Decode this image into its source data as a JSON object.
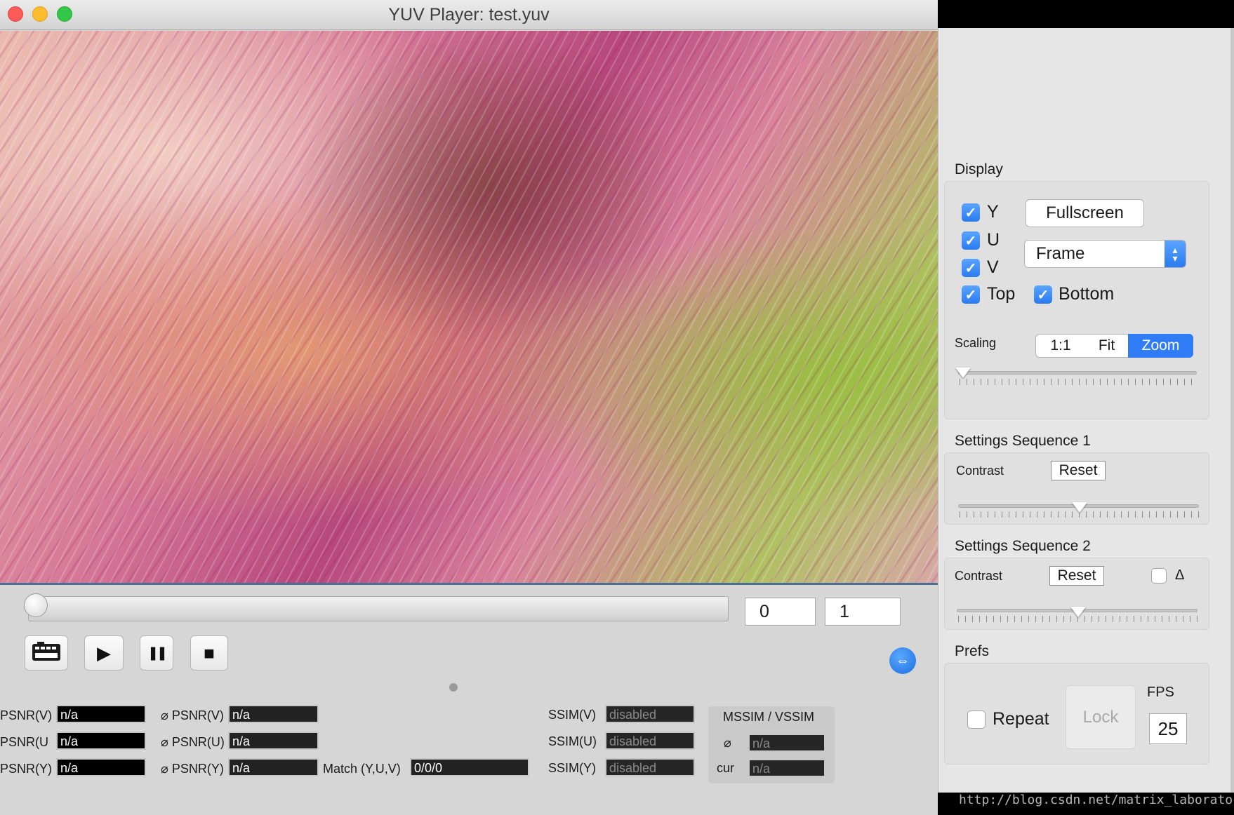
{
  "window": {
    "title": "YUV Player: test.yuv",
    "traffic_lights": {
      "close": "#fc5b57",
      "minimize": "#fdbc2e",
      "zoom": "#33c748"
    }
  },
  "timeline": {
    "position_fraction": 0.0,
    "frame_start": "0",
    "frame_end": "1"
  },
  "transport": {
    "buttons": [
      {
        "name": "snapshot-button",
        "icon": "film-frame-icon"
      },
      {
        "name": "play-button",
        "icon": "play-icon",
        "glyph": "▶"
      },
      {
        "name": "pause-button",
        "icon": "pause-icon",
        "glyph": "❚❚"
      },
      {
        "name": "stop-button",
        "icon": "stop-icon",
        "glyph": "■"
      }
    ],
    "toggle_glyph": "⇔"
  },
  "metrics": {
    "psnr_v_label": "PSNR(V)",
    "psnr_v_value": "n/a",
    "psnr_u_label": "PSNR(U",
    "psnr_u_value": "n/a",
    "psnr_y_label": "PSNR(Y)",
    "psnr_y_value": "n/a",
    "avg_symbol": "⌀",
    "avg_psnr_v_label": "PSNR(V)",
    "avg_psnr_v_value": "n/a",
    "avg_psnr_u_label": "PSNR(U)",
    "avg_psnr_u_value": "n/a",
    "avg_psnr_y_label": "PSNR(Y)",
    "avg_psnr_y_value": "n/a",
    "match_label": "Match (Y,U,V)",
    "match_value": "0/0/0",
    "ssim_v_label": "SSIM(V)",
    "ssim_v_value": "disabled",
    "ssim_u_label": "SSIM(U)",
    "ssim_u_value": "disabled",
    "ssim_y_label": "SSIM(Y)",
    "ssim_y_value": "disabled",
    "mssim_title": "MSSIM / VSSIM",
    "mssim_avg_label": "⌀",
    "mssim_avg_value": "n/a",
    "mssim_cur_label": "cur",
    "mssim_cur_value": "n/a"
  },
  "drawer": {
    "display": {
      "title": "Display",
      "y": {
        "label": "Y",
        "checked": true
      },
      "u": {
        "label": "U",
        "checked": true
      },
      "v": {
        "label": "V",
        "checked": true
      },
      "top": {
        "label": "Top",
        "checked": true
      },
      "bottom": {
        "label": "Bottom",
        "checked": true
      },
      "fullscreen_label": "Fullscreen",
      "mode_select": "Frame",
      "scaling_label": "Scaling",
      "scaling_options": [
        "1:1",
        "Fit",
        "Zoom"
      ],
      "scaling_selected": "Zoom",
      "zoom_fraction": 0.0
    },
    "seq1": {
      "title": "Settings Sequence 1",
      "contrast_label": "Contrast",
      "reset_label": "Reset",
      "contrast_fraction": 0.5
    },
    "seq2": {
      "title": "Settings Sequence 2",
      "contrast_label": "Contrast",
      "reset_label": "Reset",
      "delta_label": "Δ",
      "delta_checked": false,
      "contrast_fraction": 0.5
    },
    "prefs": {
      "title": "Prefs",
      "repeat_label": "Repeat",
      "repeat_checked": false,
      "lock_label": "Lock",
      "fps_label": "FPS",
      "fps_value": "25"
    }
  },
  "watermark": "http://blog.csdn.net/matrix_laboratory",
  "colors": {
    "accent": "#2f7cf6",
    "window_bg": "#d6d6d6",
    "drawer_bg": "#e6e6e6"
  }
}
